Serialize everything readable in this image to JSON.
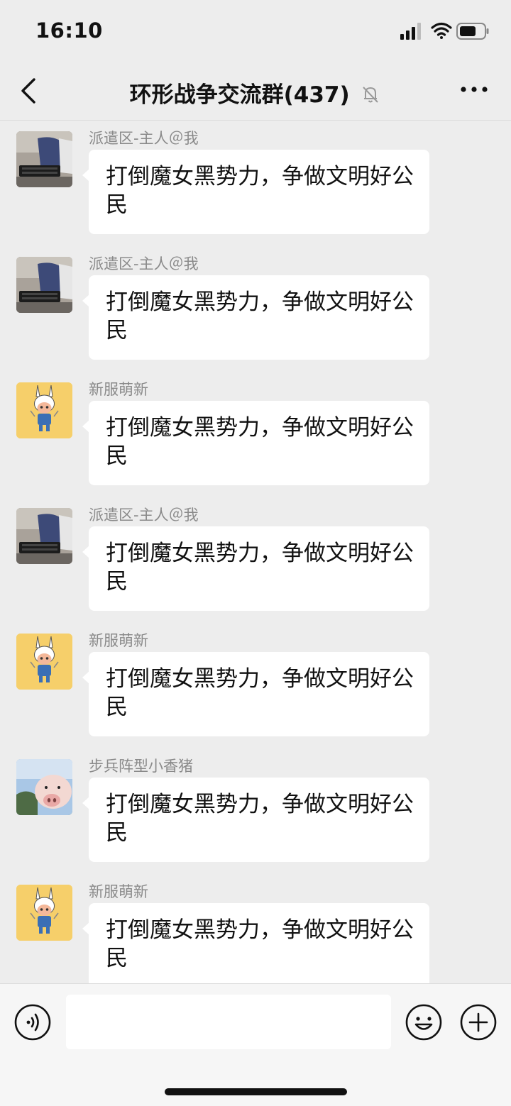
{
  "status_bar": {
    "time": "16:10",
    "signal_icon": "cellular-signal-icon",
    "wifi_icon": "wifi-icon",
    "battery_icon": "battery-icon"
  },
  "nav": {
    "back_icon": "chevron-left-icon",
    "title": "环形战争交流群(437)",
    "mute_icon": "bell-muted-icon",
    "more_icon": "more-dots-icon"
  },
  "messages": [
    {
      "sender": "派遣区-主人＠我",
      "text": "打倒魔女黑势力，争做文明好公民",
      "avatar": "desk-photo-avatar"
    },
    {
      "sender": "派遣区-主人＠我",
      "text": "打倒魔女黑势力，争做文明好公民",
      "avatar": "desk-photo-avatar"
    },
    {
      "sender": "新服萌新",
      "text": "打倒魔女黑势力，争做文明好公民",
      "avatar": "cartoon-avatar"
    },
    {
      "sender": "派遣区-主人＠我",
      "text": "打倒魔女黑势力，争做文明好公民",
      "avatar": "desk-photo-avatar"
    },
    {
      "sender": "新服萌新",
      "text": "打倒魔女黑势力，争做文明好公民",
      "avatar": "cartoon-avatar"
    },
    {
      "sender": "步兵阵型小香猪",
      "text": "打倒魔女黑势力，争做文明好公民",
      "avatar": "pig-photo-avatar"
    },
    {
      "sender": "新服萌新",
      "text": "打倒魔女黑势力，争做文明好公民",
      "avatar": "cartoon-avatar"
    }
  ],
  "input": {
    "value": "",
    "voice_icon": "voice-icon",
    "emoji_icon": "emoji-icon",
    "plus_icon": "plus-icon"
  },
  "colors": {
    "background": "#ededed",
    "bubble": "#ffffff",
    "sender_text": "#8a8a8a"
  }
}
